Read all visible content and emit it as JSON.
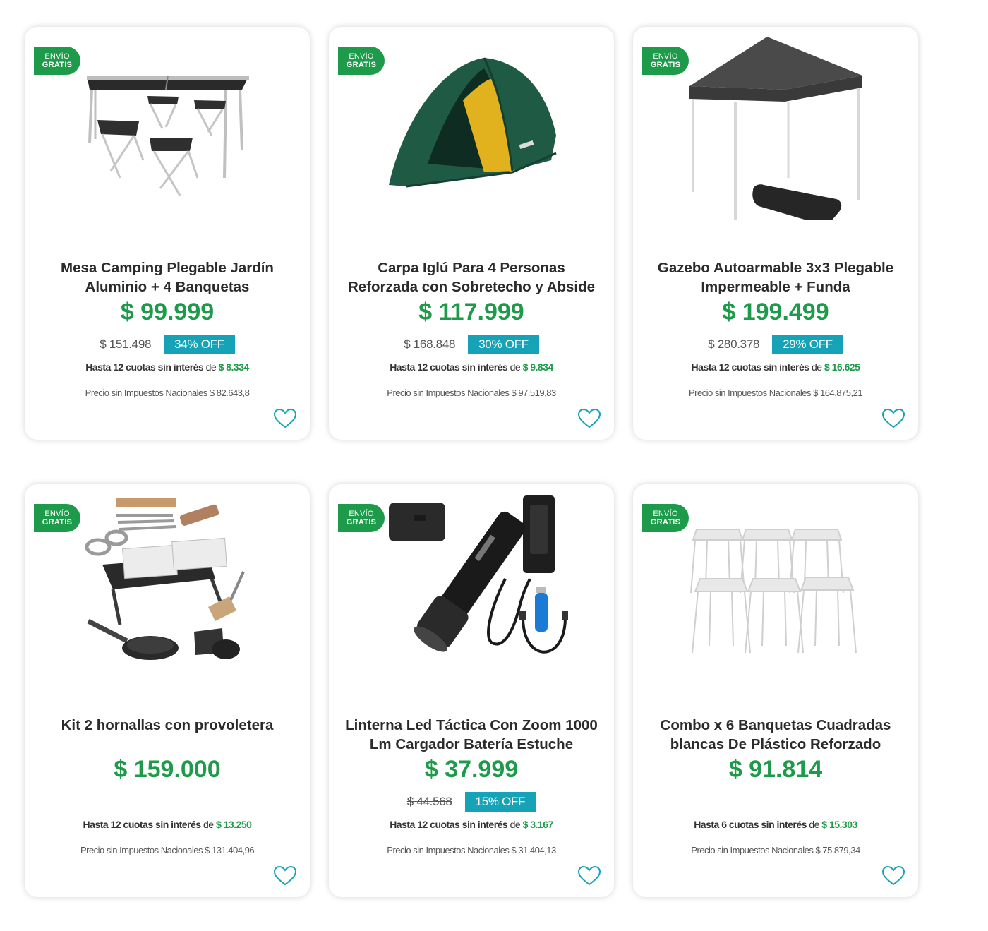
{
  "colors": {
    "brand_green": "#1e9b4a",
    "discount_teal": "#16a3b8",
    "heart_outline": "#16a3b8"
  },
  "shipping_badge": {
    "line1": "ENVÍO",
    "line2": "GRATIS"
  },
  "labels": {
    "tax_prefix": "Precio sin Impuestos Nacionales",
    "fees_connector": "de"
  },
  "products": [
    {
      "image": "folding-table-4-stools",
      "free_shipping": true,
      "title_line1": "Mesa Camping Plegable Jardín",
      "title_line2": "Aluminio + 4 Banquetas",
      "price": "$ 99.999",
      "old_price": "$ 151.498",
      "discount": "34% OFF",
      "fees_text": "Hasta 12 cuotas sin interés",
      "fees_amount": "$ 8.334",
      "tax_value": "$ 82.643,8"
    },
    {
      "image": "dome-tent",
      "free_shipping": true,
      "title_line1": "Carpa Iglú Para 4 Personas",
      "title_line2": "Reforzada con Sobretecho y Abside",
      "price": "$ 117.999",
      "old_price": "$ 168.848",
      "discount": "30% OFF",
      "fees_text": "Hasta 12 cuotas sin interés",
      "fees_amount": "$ 9.834",
      "tax_value": "$ 97.519,83"
    },
    {
      "image": "gazebo",
      "free_shipping": true,
      "title_line1": "Gazebo Autoarmable 3x3 Plegable",
      "title_line2": "Impermeable + Funda",
      "price": "$ 199.499",
      "old_price": "$ 280.378",
      "discount": "29% OFF",
      "fees_text": "Hasta 12 cuotas sin interés",
      "fees_amount": "$ 16.625",
      "tax_value": "$ 164.875,21"
    },
    {
      "image": "grill-kit",
      "free_shipping": true,
      "title_line1": "Kit 2 hornallas con provoletera",
      "title_line2": "",
      "price": "$ 159.000",
      "old_price": "",
      "discount": "",
      "fees_text": "Hasta 12 cuotas sin interés",
      "fees_amount": "$ 13.250",
      "tax_value": "$ 131.404,96"
    },
    {
      "image": "tactical-flashlight",
      "free_shipping": true,
      "title_line1": "Linterna Led Táctica Con Zoom 1000",
      "title_line2": "Lm Cargador Batería Estuche",
      "price": "$ 37.999",
      "old_price": "$ 44.568",
      "discount": "15% OFF",
      "fees_text": "Hasta 12 cuotas sin interés",
      "fees_amount": "$ 3.167",
      "tax_value": "$ 31.404,13"
    },
    {
      "image": "plastic-stools-x6",
      "free_shipping": true,
      "title_line1": "Combo x 6 Banquetas Cuadradas",
      "title_line2": "blancas De Plástico Reforzado",
      "price": "$ 91.814",
      "old_price": "",
      "discount": "",
      "fees_text": "Hasta 6 cuotas sin interés",
      "fees_amount": "$ 15.303",
      "tax_value": "$ 75.879,34"
    }
  ]
}
